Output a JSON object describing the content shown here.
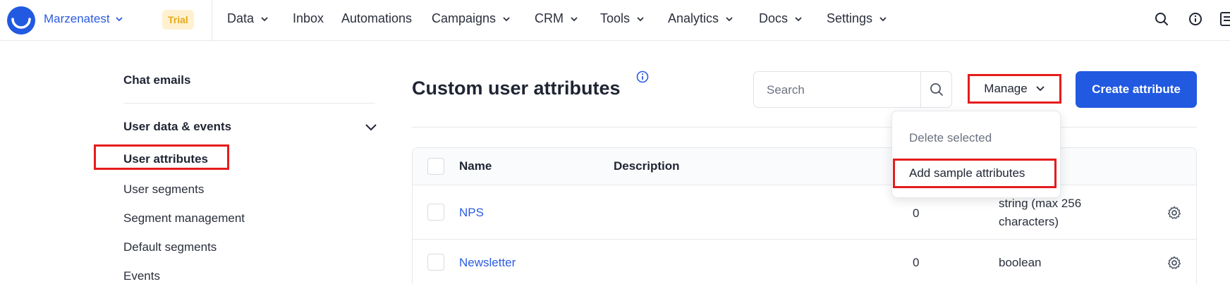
{
  "topbar": {
    "account_name": "Marzenatest",
    "trial_badge": "Trial",
    "nav": [
      {
        "label": "Data",
        "has_dropdown": true
      },
      {
        "label": "Inbox",
        "has_dropdown": false
      },
      {
        "label": "Automations",
        "has_dropdown": false
      },
      {
        "label": "Campaigns",
        "has_dropdown": true
      },
      {
        "label": "CRM",
        "has_dropdown": true
      },
      {
        "label": "Tools",
        "has_dropdown": true
      },
      {
        "label": "Analytics",
        "has_dropdown": true
      },
      {
        "label": "Docs",
        "has_dropdown": true
      },
      {
        "label": "Settings",
        "has_dropdown": true
      }
    ],
    "icons": [
      "search-icon",
      "info-icon",
      "docs-icon"
    ]
  },
  "sidebar": {
    "top_item": "Chat emails",
    "section_title": "User data & events",
    "items": [
      {
        "label": "User attributes",
        "active": true
      },
      {
        "label": "User segments",
        "active": false
      },
      {
        "label": "Segment management",
        "active": false
      },
      {
        "label": "Default segments",
        "active": false
      },
      {
        "label": "Events",
        "active": false
      }
    ]
  },
  "main": {
    "title": "Custom user attributes",
    "search_placeholder": "Search",
    "manage_label": "Manage",
    "create_label": "Create attribute",
    "manage_menu": [
      {
        "label": "Delete selected",
        "enabled": false
      },
      {
        "label": "Add sample attributes",
        "enabled": true
      }
    ],
    "table": {
      "headers": {
        "name": "Name",
        "description": "Description"
      },
      "rows": [
        {
          "name": "NPS",
          "description": "",
          "count": "0",
          "type_line1": "string (max 256",
          "type_line2": "characters)"
        },
        {
          "name": "Newsletter",
          "description": "",
          "count": "0",
          "type_line1": "boolean",
          "type_line2": ""
        }
      ]
    }
  },
  "colors": {
    "brand_blue": "#2159e0",
    "link_blue": "#2b5ce0",
    "trial_bg": "#fff1cf",
    "trial_text": "#e6a819",
    "highlight_red": "#e51c1c"
  }
}
